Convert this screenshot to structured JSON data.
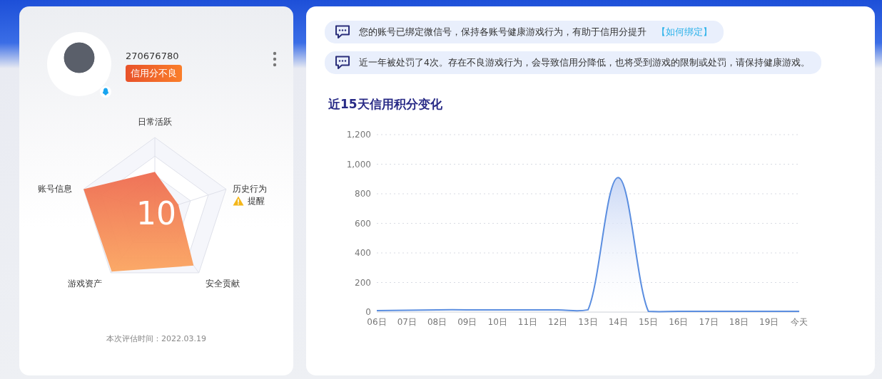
{
  "profile": {
    "account_id": "270676780",
    "status_badge": "信用分不良",
    "score": "10",
    "evaluated_at": "本次评估时间：2022.03.19",
    "radar": [
      {
        "label": "日常活跃"
      },
      {
        "label": "历史行为",
        "alert": "提醒"
      },
      {
        "label": "安全贡献"
      },
      {
        "label": "游戏资产"
      },
      {
        "label": "账号信息"
      }
    ]
  },
  "notices": [
    {
      "text": "您的账号已绑定微信号，保持各账号健康游戏行为，有助于信用分提升",
      "link": "【如何绑定】"
    },
    {
      "text": "近一年被处罚了4次。存在不良游戏行为，会导致信用分降低，也将受到游戏的限制或处罚，请保持健康游戏。"
    }
  ],
  "credit_chart": {
    "chart_data": {
      "type": "area",
      "title": "近15天信用积分变化",
      "categories": [
        "06日",
        "07日",
        "08日",
        "09日",
        "10日",
        "11日",
        "12日",
        "13日",
        "14日",
        "15日",
        "16日",
        "17日",
        "18日",
        "19日",
        "今天"
      ],
      "series": [
        {
          "color": "#5b8ee0",
          "values": [
            10,
            12,
            15,
            15,
            15,
            15,
            15,
            15,
            910,
            5,
            5,
            5,
            5,
            5,
            5
          ]
        }
      ],
      "ylim": [
        0,
        1200
      ],
      "grid": true,
      "yticks": [
        0,
        200,
        400,
        600,
        800,
        {
          "value": 1000,
          "label": "1,000"
        },
        {
          "value": 1200,
          "label": "1,200"
        }
      ]
    }
  }
}
